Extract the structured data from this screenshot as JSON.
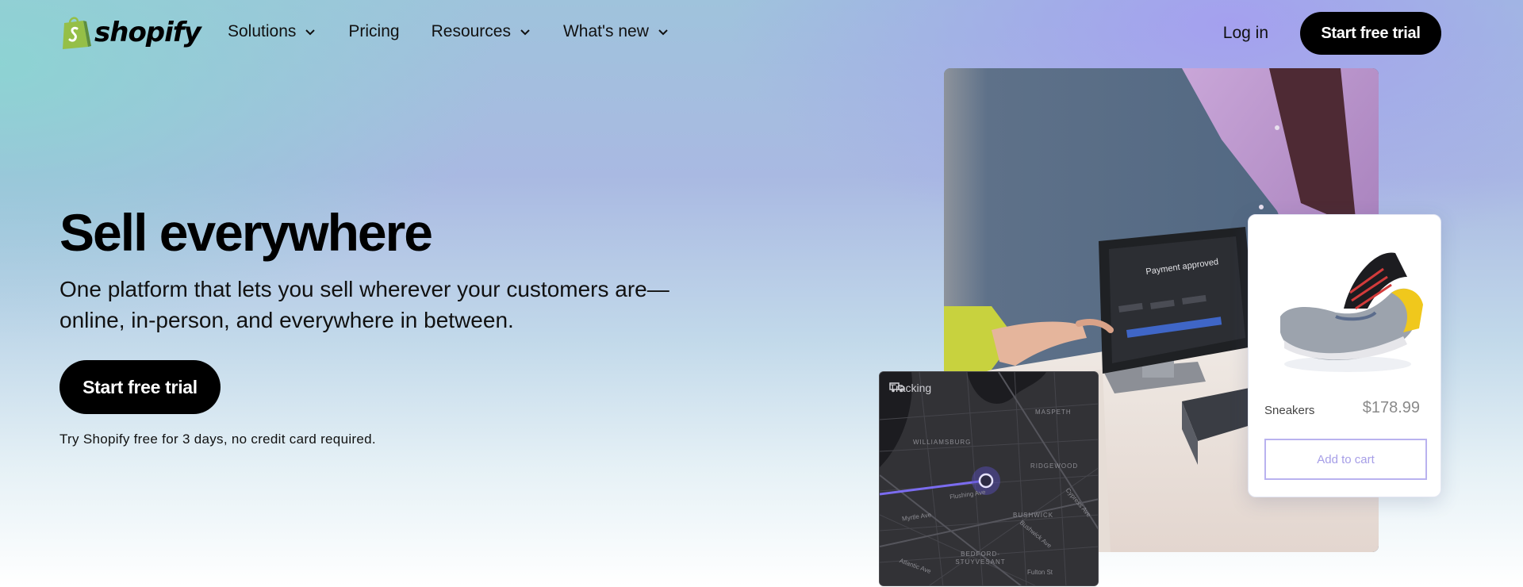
{
  "nav": {
    "logo_text": "shopify",
    "items": [
      {
        "label": "Solutions",
        "has_dropdown": true
      },
      {
        "label": "Pricing",
        "has_dropdown": false
      },
      {
        "label": "Resources",
        "has_dropdown": true
      },
      {
        "label": "What's new",
        "has_dropdown": true
      }
    ],
    "login_label": "Log in",
    "cta_label": "Start free trial"
  },
  "hero": {
    "title": "Sell everywhere",
    "subtitle": "One platform that lets you sell wherever your customers are—online, in-person, and everywhere in between.",
    "cta_label": "Start free trial",
    "note": "Try Shopify free for 3 days, no credit card required."
  },
  "pos_screen": {
    "title": "Payment approved"
  },
  "product_card": {
    "name": "Sneakers",
    "price": "$178.99",
    "button_label": "Add to cart"
  },
  "map": {
    "title": "Tracking",
    "labels": [
      "WILLIAMSBURG",
      "MASPETH",
      "RIDGEWOOD",
      "BUSHWICK",
      "BEDFORD-STUYVESANT",
      "Flushing Ave",
      "Myrtle Ave",
      "Atlantic Ave",
      "Cypress Ave",
      "Bushwick Ave",
      "Fulton St"
    ]
  },
  "colors": {
    "brand_green": "#95bf47",
    "cta_bg": "#000000",
    "accent_purple": "#a69ee7",
    "route_purple": "#7b6cf0"
  }
}
